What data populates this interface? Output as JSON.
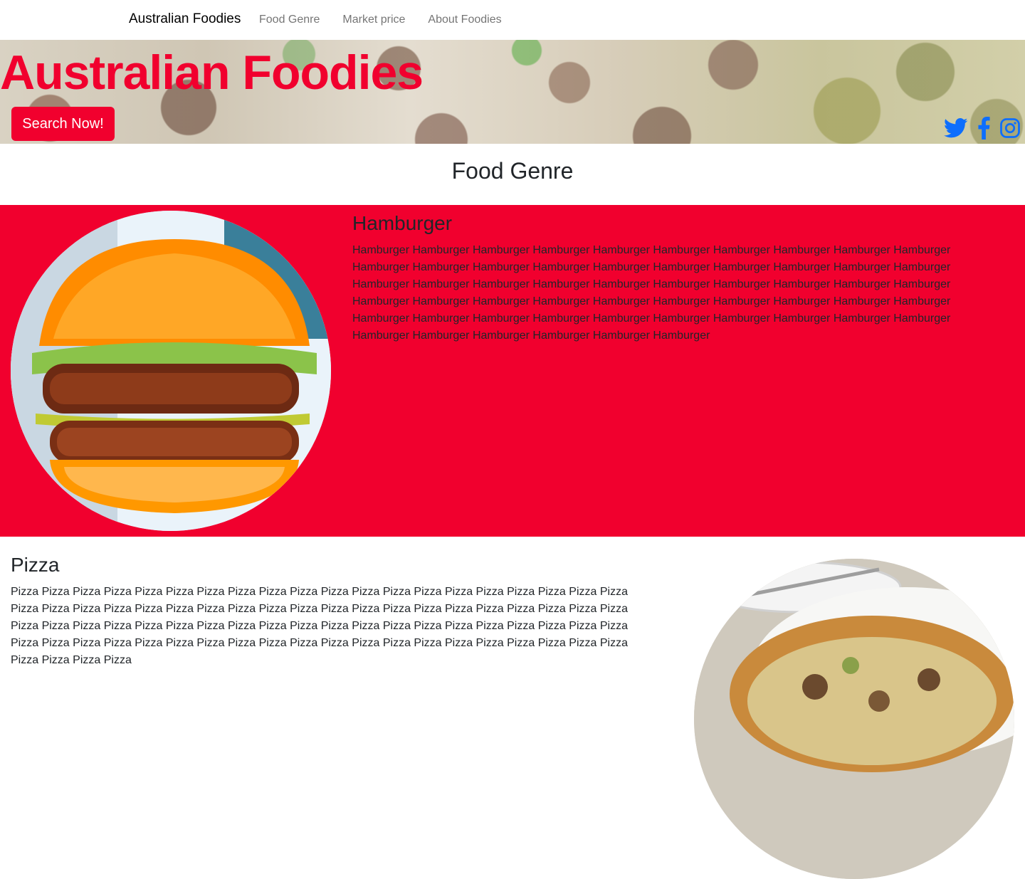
{
  "nav": {
    "brand": "Australian Foodies",
    "links": [
      "Food Genre",
      "Market price",
      "About Foodies"
    ]
  },
  "hero": {
    "title": "Australian Foodies",
    "search_label": "Search Now!",
    "social_icons": [
      "twitter-icon",
      "facebook-icon",
      "instagram-icon"
    ]
  },
  "section_title": "Food Genre",
  "genres": {
    "hamburger": {
      "heading": "Hamburger",
      "text": "Hamburger Hamburger Hamburger Hamburger Hamburger Hamburger Hamburger Hamburger Hamburger Hamburger Hamburger Hamburger Hamburger Hamburger Hamburger Hamburger Hamburger Hamburger Hamburger Hamburger Hamburger Hamburger Hamburger Hamburger Hamburger Hamburger Hamburger Hamburger Hamburger Hamburger Hamburger Hamburger Hamburger Hamburger Hamburger Hamburger Hamburger Hamburger Hamburger Hamburger Hamburger Hamburger Hamburger Hamburger Hamburger Hamburger Hamburger Hamburger Hamburger Hamburger Hamburger Hamburger Hamburger Hamburger Hamburger Hamburger"
    },
    "pizza": {
      "heading": "Pizza",
      "text": "Pizza Pizza Pizza Pizza Pizza Pizza Pizza Pizza Pizza Pizza Pizza Pizza Pizza Pizza Pizza Pizza Pizza Pizza Pizza Pizza Pizza Pizza Pizza Pizza Pizza Pizza Pizza Pizza Pizza Pizza Pizza Pizza Pizza Pizza Pizza Pizza Pizza Pizza Pizza Pizza Pizza Pizza Pizza Pizza Pizza Pizza Pizza Pizza Pizza Pizza Pizza Pizza Pizza Pizza Pizza Pizza Pizza Pizza Pizza Pizza Pizza Pizza Pizza Pizza Pizza Pizza Pizza Pizza Pizza Pizza Pizza Pizza Pizza Pizza Pizza Pizza Pizza Pizza Pizza Pizza Pizza Pizza Pizza Pizza"
    }
  },
  "colors": {
    "accent_red": "#f1002e",
    "social_blue": "#0d6efd"
  }
}
